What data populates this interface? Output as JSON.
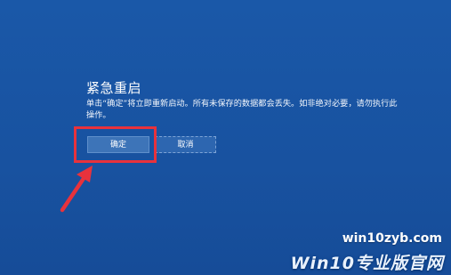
{
  "dialog": {
    "title": "紧急重启",
    "message": "单击“确定”将立即重新启动。所有未保存的数据都会丢失。如非绝对必要，请勿执行此操作。",
    "confirm_label": "确定",
    "cancel_label": "取消"
  },
  "watermark": {
    "url": "win10zyb.com",
    "brand": "Win10专业版官网"
  },
  "colors": {
    "background": "#1a56a6",
    "highlight": "#e8323c",
    "button": "#3d74b8"
  }
}
